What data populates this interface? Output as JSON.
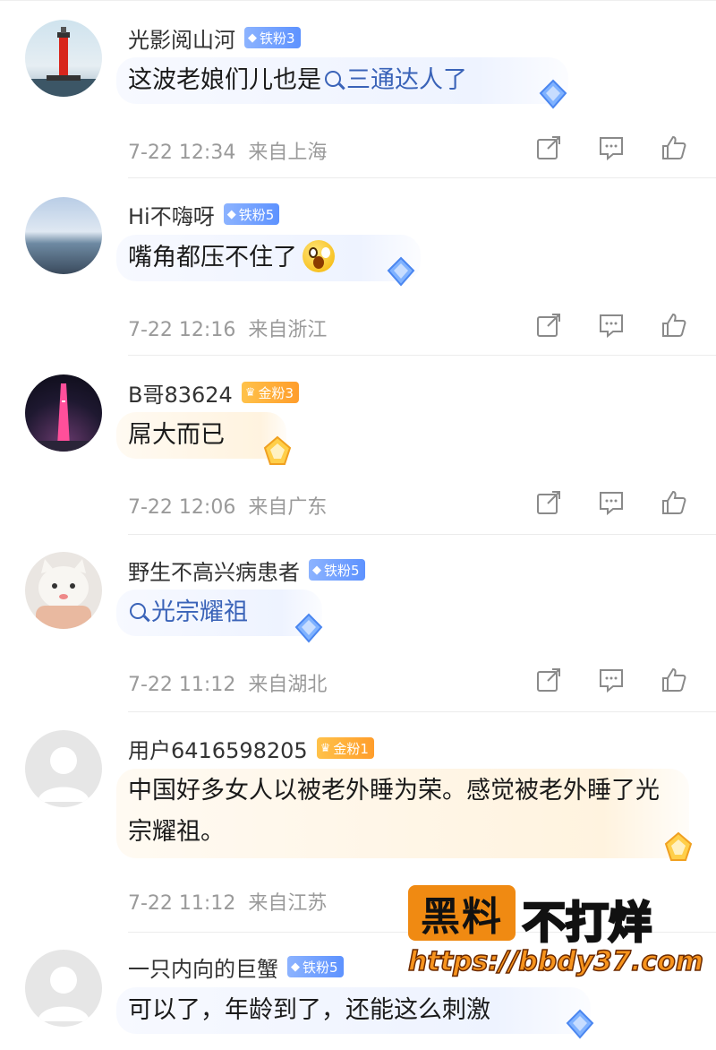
{
  "comments": [
    {
      "username": "光影阅山河",
      "badge_text": "铁粉3",
      "badge_type": "iron",
      "content_pre": "这波老娘们儿也是",
      "content_link": "三通达人了",
      "time": "7-22 12:34",
      "location": "来自上海",
      "avatar": "lighthouse"
    },
    {
      "username": "Hi不嗨呀",
      "badge_text": "铁粉5",
      "badge_type": "iron",
      "content": "嘴角都压不住了",
      "emoji": "shocked-face-emoji",
      "time": "7-22 12:16",
      "location": "来自浙江",
      "avatar": "seaside"
    },
    {
      "username": "B哥83624",
      "badge_text": "金粉3",
      "badge_type": "gold",
      "content": "屌大而已",
      "time": "7-22 12:06",
      "location": "来自广东",
      "avatar": "tower-night"
    },
    {
      "username": "野生不高兴病患者",
      "badge_text": "铁粉5",
      "badge_type": "iron",
      "content_link": "光宗耀祖",
      "time": "7-22 11:12",
      "location": "来自湖北",
      "avatar": "cat"
    },
    {
      "username": "用户6416598205",
      "badge_text": "金粉1",
      "badge_type": "gold",
      "content": "中国好多女人以被老外睡为荣。感觉被老外睡了光宗耀祖。",
      "time": "7-22 11:12",
      "location": "来自江苏",
      "avatar": "default"
    },
    {
      "username": "一只内向的巨蟹",
      "badge_text": "铁粉5",
      "badge_type": "iron",
      "content": "可以了，年龄到了，还能这么刺激",
      "avatar": "default"
    }
  ],
  "watermark": {
    "box_text": "黑料",
    "text": "不打烊",
    "url": "https://bbdy37.com"
  },
  "colors": {
    "iron_badge": "#5d92ff",
    "gold_badge": "#ff9d2b",
    "link": "#3a63b8",
    "meta_gray": "#9a9a9a",
    "watermark_orange": "#f08a12"
  }
}
